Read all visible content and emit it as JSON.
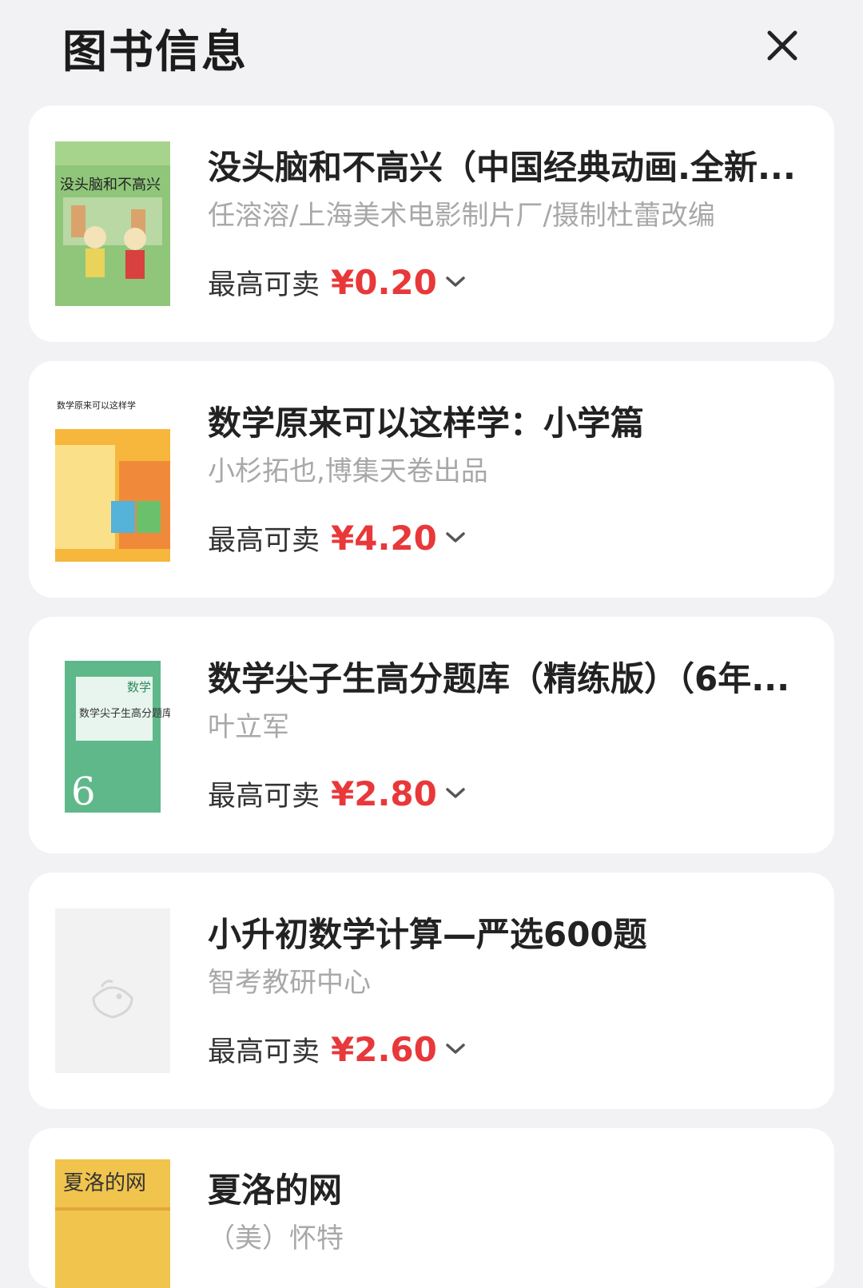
{
  "header": {
    "title": "图书信息",
    "close_icon": "close-icon"
  },
  "price_label": "最高可卖",
  "colors": {
    "price": "#e8383a",
    "author": "#a8a8a8",
    "background": "#f2f2f4"
  },
  "books": [
    {
      "title": "没头脑和不高兴（中国经典动画.全新...",
      "author": "任溶溶/上海美术电影制片厂/摄制杜蕾改编",
      "price": "¥0.20",
      "cover": {
        "title_text": "没头脑和不高兴",
        "bg": "#8fc67a"
      }
    },
    {
      "title": "数学原来可以这样学：小学篇",
      "author": "小杉拓也,博集天卷出品",
      "price": "¥4.20",
      "cover": {
        "title_text": "数学原来可以这样学",
        "bg": "#f6b73c"
      }
    },
    {
      "title": "数学尖子生高分题库（精练版）（6年...",
      "author": "叶立军",
      "price": "¥2.80",
      "cover": {
        "title_text": "数学尖子生高分题库",
        "bg": "#5fb88a"
      }
    },
    {
      "title": "小升初数学计算—严选600题",
      "author": "智考教研中心",
      "price": "¥2.60",
      "cover": {
        "title_text": "",
        "bg": "#f2f2f2"
      }
    },
    {
      "title": "夏洛的网",
      "author": "（美）怀特",
      "price": "",
      "cover": {
        "title_text": "夏洛的网",
        "bg": "#f1c44e"
      }
    }
  ]
}
